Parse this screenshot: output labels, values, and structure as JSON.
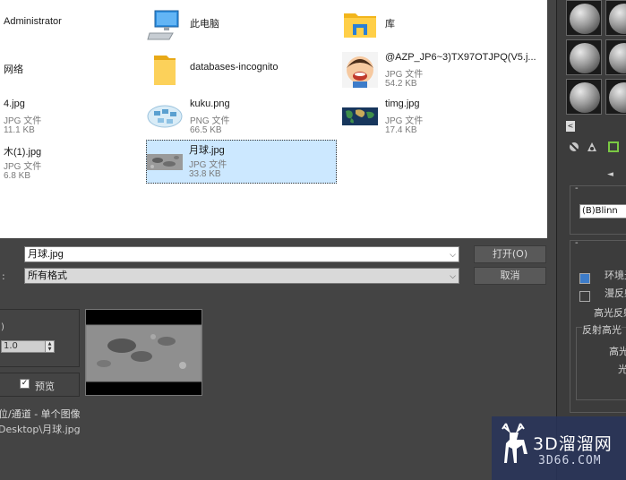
{
  "file_list": [
    {
      "name": "Administrator",
      "type": "",
      "size": ""
    },
    {
      "name": "此电脑",
      "type": "",
      "size": ""
    },
    {
      "name": "库",
      "type": "",
      "size": ""
    },
    {
      "name": "网络",
      "type": "",
      "size": ""
    },
    {
      "name": "databases-incognito",
      "type": "",
      "size": ""
    },
    {
      "name": "@AZP_JP6~3)TX97OTJPQ(V5.j...",
      "type": "JPG 文件",
      "size": "54.2 KB"
    },
    {
      "name": "4.jpg",
      "type": "JPG 文件",
      "size": "11.1 KB"
    },
    {
      "name": "kuku.png",
      "type": "PNG 文件",
      "size": "66.5 KB"
    },
    {
      "name": "timg.jpg",
      "type": "JPG 文件",
      "size": "17.4 KB"
    },
    {
      "name": "木(1).jpg",
      "type": "JPG 文件",
      "size": "6.8 KB"
    },
    {
      "name": "月球.jpg",
      "type": "JPG 文件",
      "size": "33.8 KB"
    }
  ],
  "dialog": {
    "filename_value": "月球.jpg",
    "filter_value": "所有格式",
    "open_label": "打开(O)",
    "cancel_label": "取消",
    "gamma_value": "1.0",
    "preview_label": "预览",
    "info_line1": "位/通道 - 单个图像",
    "info_line2": "Desktop\\月球.jpg"
  },
  "right_panel": {
    "shader": "(B)Blinn",
    "labels": [
      "环境光",
      "漫反射",
      "高光反射",
      "反射高光",
      "高光",
      "光"
    ]
  },
  "watermark": {
    "big": "3D溜溜网",
    "small": "3D66.COM"
  }
}
